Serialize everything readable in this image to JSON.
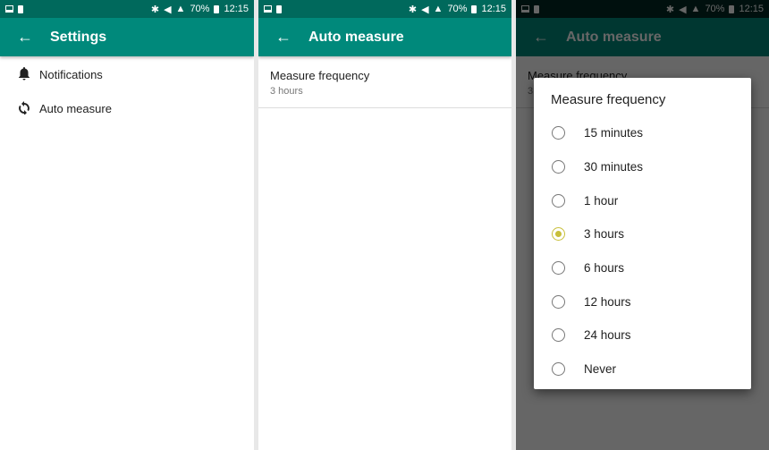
{
  "status_bar": {
    "battery": "70%",
    "time": "12:15"
  },
  "screen1": {
    "title": "Settings",
    "items": [
      {
        "label": "Notifications",
        "icon": "bell-icon"
      },
      {
        "label": "Auto measure",
        "icon": "sync-icon"
      }
    ]
  },
  "screen2": {
    "title": "Auto measure",
    "pref": {
      "title": "Measure frequency",
      "summary": "3 hours"
    }
  },
  "screen3": {
    "title": "Auto measure",
    "dialog": {
      "title": "Measure frequency",
      "selected": "3 hours",
      "options": [
        "15 minutes",
        "30 minutes",
        "1 hour",
        "3 hours",
        "6 hours",
        "12 hours",
        "24 hours",
        "Never"
      ]
    }
  },
  "colors": {
    "status_bar": "#00695c",
    "toolbar": "#00897b",
    "radio_selected": "#c8bf3a"
  }
}
